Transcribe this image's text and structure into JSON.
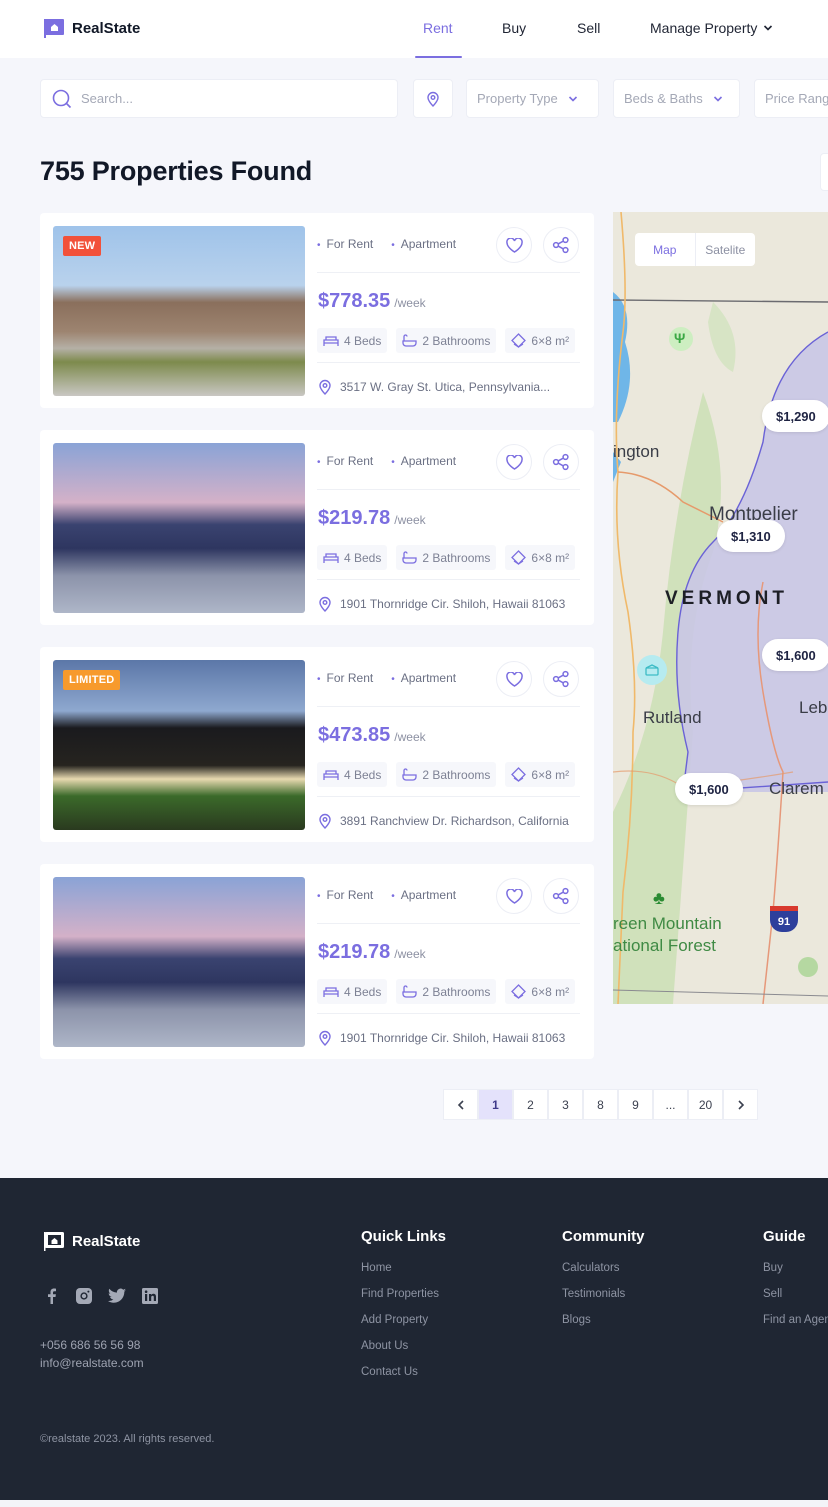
{
  "brand": {
    "name": "RealState",
    "accent": "#7b6ee0"
  },
  "nav": {
    "items": [
      {
        "label": "Rent",
        "active": true
      },
      {
        "label": "Buy",
        "active": false
      },
      {
        "label": "Sell",
        "active": false
      },
      {
        "label": "Manage Property",
        "active": false,
        "dropdown": true
      }
    ]
  },
  "filters": {
    "search_placeholder": "Search...",
    "location_icon": "map-pin-icon",
    "property_type": "Property Type",
    "beds_baths": "Beds & Baths",
    "price_range": "Price Range"
  },
  "results": {
    "title": "755 Properties Found"
  },
  "listings": [
    {
      "badge": "NEW",
      "badge_color": "#f2513a",
      "status": "For Rent",
      "type": "Apartment",
      "price": "$778.35",
      "period": "/week",
      "beds": "4 Beds",
      "baths": "2 Bathrooms",
      "area": "6×8 m²",
      "address": "3517 W. Gray St. Utica, Pennsylvania..."
    },
    {
      "badge": "",
      "status": "For Rent",
      "type": "Apartment",
      "price": "$219.78",
      "period": "/week",
      "beds": "4 Beds",
      "baths": "2 Bathrooms",
      "area": "6×8 m²",
      "address": "1901 Thornridge Cir. Shiloh, Hawaii 81063"
    },
    {
      "badge": "LIMITED",
      "badge_color": "#f79a2c",
      "status": "For Rent",
      "type": "Apartment",
      "price": "$473.85",
      "period": "/week",
      "beds": "4 Beds",
      "baths": "2 Bathrooms",
      "area": "6×8 m²",
      "address": "3891 Ranchview Dr. Richardson, California"
    },
    {
      "badge": "",
      "status": "For Rent",
      "type": "Apartment",
      "price": "$219.78",
      "period": "/week",
      "beds": "4 Beds",
      "baths": "2 Bathrooms",
      "area": "6×8 m²",
      "address": "1901 Thornridge Cir. Shiloh, Hawaii 81063"
    }
  ],
  "map": {
    "toggle": {
      "map": "Map",
      "satellite": "Satelite",
      "active": "Map"
    },
    "price_pins": [
      "$1,290",
      "$1,310",
      "$1,600",
      "$1,600"
    ],
    "labels": {
      "burlington": "ington",
      "montpelier": "Montpelier",
      "vermont": "VERMONT",
      "rutland": "Rutland",
      "lebanon": "Leb",
      "claremont": "Clarem",
      "forest1": "reen Mountain",
      "forest2": "ational Forest",
      "interstate": "91"
    }
  },
  "pagination": {
    "prev": "‹",
    "pages": [
      "1",
      "2",
      "3",
      "8",
      "9",
      "...",
      "20"
    ],
    "current": "1",
    "next": "›"
  },
  "footer": {
    "brand": "RealState",
    "socials": [
      "facebook",
      "instagram",
      "twitter",
      "linkedin"
    ],
    "phone": "+056 686 56 56 98",
    "email": "info@realstate.com",
    "columns": [
      {
        "title": "Quick Links",
        "links": [
          "Home",
          "Find Properties",
          "Add Property",
          "About Us",
          "Contact Us"
        ]
      },
      {
        "title": "Community",
        "links": [
          "Calculators",
          "Testimonials",
          "Blogs"
        ]
      },
      {
        "title": "Guide",
        "links": [
          "Buy",
          "Sell",
          "Find an Agent"
        ]
      }
    ],
    "copyright": "©realstate 2023. All rights reserved."
  }
}
